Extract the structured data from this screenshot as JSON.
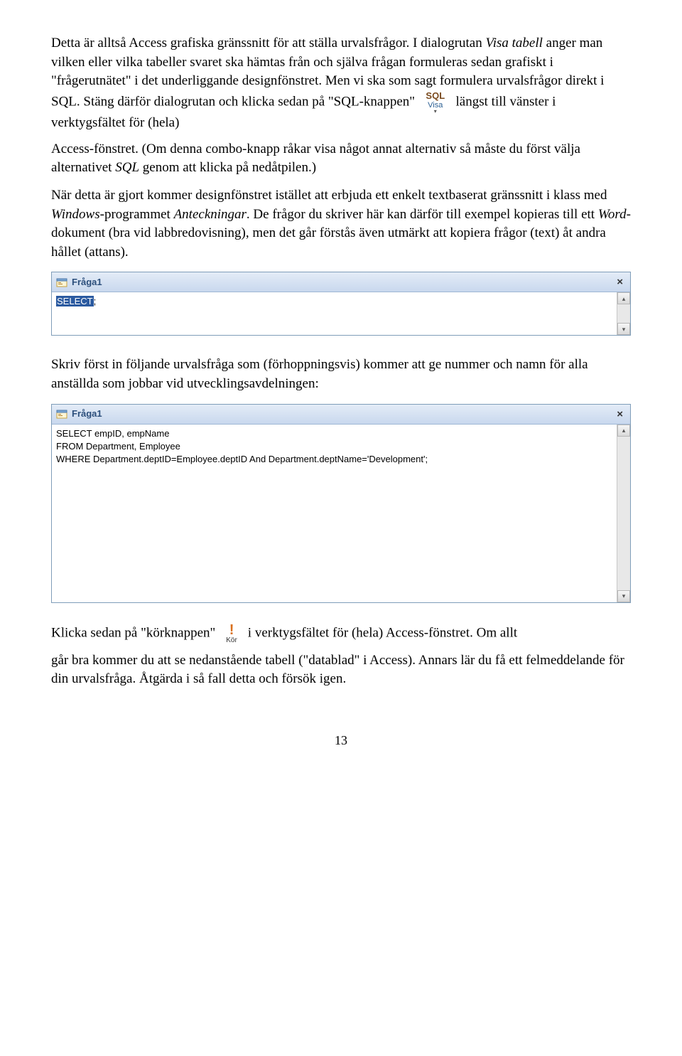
{
  "para1a": "Detta är alltså Access grafiska gränssnitt för att ställa urvalsfrågor. I dialogrutan ",
  "para1b": "Visa tabell",
  "para1c": " anger man vilken eller vilka tabeller svaret ska hämtas från och själva frågan formuleras sedan grafiskt i \"frågerutnätet\" i det underliggande designfönstret. Men vi ska som sagt formulera urvalsfrågor direkt i SQL. Stäng därför dialogrutan och klicka sedan på \"SQL-knappen\" ",
  "sql_btn": {
    "sql": "SQL",
    "label": "Visa"
  },
  "para1d": " längst till vänster i verktygsfältet för (hela)",
  "para2a": "Access-fönstret. (Om denna combo-knapp råkar visa något annat alternativ så måste du först välja alternativet ",
  "para2b": "SQL",
  "para2c": " genom att klicka på nedåtpilen.)",
  "para3a": "När detta är gjort kommer designfönstret istället att erbjuda ett enkelt textbaserat gränssnitt i klass med ",
  "para3b": "Windows",
  "para3c": "-programmet ",
  "para3d": "Anteckningar",
  "para3e": ". De frågor du skriver här kan därför till exempel kopieras till ett ",
  "para3f": "Word",
  "para3g": "-dokument (bra vid labbredovisning), men det går förstås även utmärkt att kopiera frågor (text) åt andra hållet (attans).",
  "win1": {
    "title": "Fråga1",
    "select_kw": "SELECT",
    "rest": ";"
  },
  "para4": "Skriv först in följande urvalsfråga som (förhoppningsvis) kommer att ge nummer och namn för alla anställda som jobbar vid utvecklingsavdelningen:",
  "win2": {
    "title": "Fråga1",
    "line1": "SELECT empID, empName",
    "line2": "FROM Department, Employee",
    "line3": "WHERE Department.deptID=Employee.deptID And Department.deptName='Development';"
  },
  "para5a": "Klicka sedan på \"körknappen\" ",
  "run_btn": {
    "mark": "!",
    "label": "Kör"
  },
  "para5b": " i verktygsfältet för (hela) Access-fönstret. Om allt",
  "para6": "går bra kommer du att se nedanstående tabell (\"datablad\" i Access). Annars lär du få ett felmeddelande för din urvalsfråga. Åtgärda i så fall detta och försök igen.",
  "page_number": "13"
}
